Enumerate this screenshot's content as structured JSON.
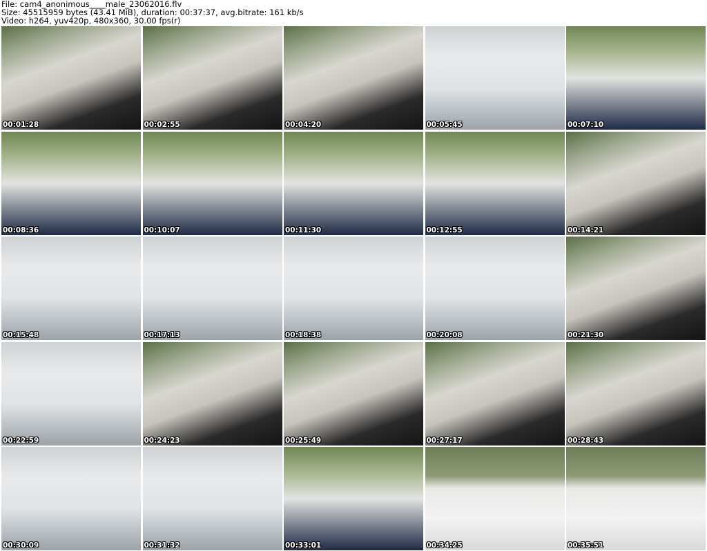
{
  "header": {
    "file_line": "File: cam4_anonimous____male_23062016.flv",
    "size_line": "Size: 45515959 bytes (43.41 MiB), duration: 00:37:37, avg.bitrate: 161 kb/s",
    "video_line": "Video: h264, yuv420p, 480x360, 30.00 fps(r)"
  },
  "thumbnails": [
    {
      "time": "00:01:28",
      "scene": "car"
    },
    {
      "time": "00:02:55",
      "scene": "car"
    },
    {
      "time": "00:04:20",
      "scene": "car"
    },
    {
      "time": "00:05:45",
      "scene": "close"
    },
    {
      "time": "00:07:10",
      "scene": "outside"
    },
    {
      "time": "00:08:36",
      "scene": "outside"
    },
    {
      "time": "00:10:07",
      "scene": "outside"
    },
    {
      "time": "00:11:30",
      "scene": "outside"
    },
    {
      "time": "00:12:55",
      "scene": "outside"
    },
    {
      "time": "00:14:21",
      "scene": "car"
    },
    {
      "time": "00:15:48",
      "scene": "close"
    },
    {
      "time": "00:17:13",
      "scene": "close"
    },
    {
      "time": "00:18:38",
      "scene": "close"
    },
    {
      "time": "00:20:08",
      "scene": "close"
    },
    {
      "time": "00:21:30",
      "scene": "car"
    },
    {
      "time": "00:22:59",
      "scene": "close"
    },
    {
      "time": "00:24:23",
      "scene": "car"
    },
    {
      "time": "00:25:49",
      "scene": "car"
    },
    {
      "time": "00:27:17",
      "scene": "car"
    },
    {
      "time": "00:28:43",
      "scene": "car"
    },
    {
      "time": "00:30:09",
      "scene": "close"
    },
    {
      "time": "00:31:32",
      "scene": "close"
    },
    {
      "time": "00:33:01",
      "scene": "outside"
    },
    {
      "time": "00:34:25",
      "scene": "wall"
    },
    {
      "time": "00:35:51",
      "scene": "wall"
    }
  ]
}
